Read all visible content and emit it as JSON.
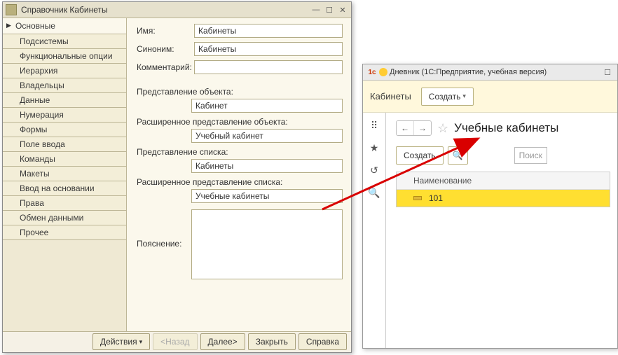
{
  "configurator": {
    "title": "Справочник Кабинеты",
    "sidebar": {
      "items": [
        {
          "label": "Основные"
        },
        {
          "label": "Подсистемы"
        },
        {
          "label": "Функциональные опции"
        },
        {
          "label": "Иерархия"
        },
        {
          "label": "Владельцы"
        },
        {
          "label": "Данные"
        },
        {
          "label": "Нумерация"
        },
        {
          "label": "Формы"
        },
        {
          "label": "Поле ввода"
        },
        {
          "label": "Команды"
        },
        {
          "label": "Макеты"
        },
        {
          "label": "Ввод на основании"
        },
        {
          "label": "Права"
        },
        {
          "label": "Обмен данными"
        },
        {
          "label": "Прочее"
        }
      ]
    },
    "form": {
      "name_label": "Имя:",
      "name_value": "Кабинеты",
      "synonym_label": "Синоним:",
      "synonym_value": "Кабинеты",
      "comment_label": "Комментарий:",
      "comment_value": "",
      "obj_repr_label": "Представление объекта:",
      "obj_repr_value": "Кабинет",
      "obj_repr_ext_label": "Расширенное представление объекта:",
      "obj_repr_ext_value": "Учебный кабинет",
      "list_repr_label": "Представление списка:",
      "list_repr_value": "Кабинеты",
      "list_repr_ext_label": "Расширенное представление списка:",
      "list_repr_ext_value": "Учебные кабинеты",
      "explain_label": "Пояснение:",
      "explain_value": ""
    },
    "footer": {
      "actions": "Действия",
      "back": "<Назад",
      "next": "Далее>",
      "close": "Закрыть",
      "help": "Справка"
    }
  },
  "enterprise": {
    "title": "Дневник  (1С:Предприятие, учебная версия)",
    "header": {
      "section": "Кабинеты",
      "create": "Создать"
    },
    "page_title": "Учебные кабинеты",
    "create_btn": "Создать",
    "search_placeholder": "Поиск",
    "table": {
      "col_name": "Наименование",
      "rows": [
        {
          "name": "101"
        }
      ]
    }
  }
}
